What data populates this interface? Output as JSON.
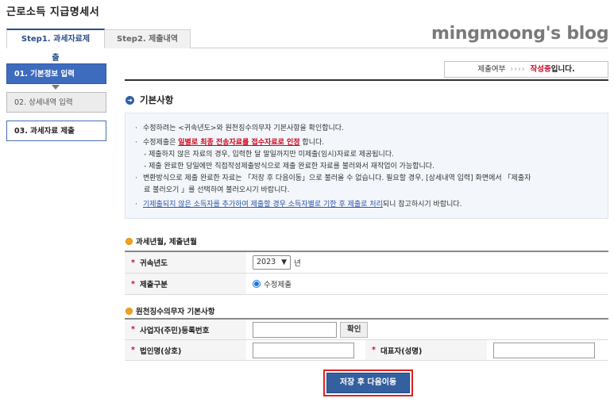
{
  "page": {
    "title": "근로소득 지급명세서"
  },
  "tabs": [
    {
      "label": "Step1. 과세자료제출"
    },
    {
      "label": "Step2. 제출내역"
    }
  ],
  "watermark": "mingmoong's blog",
  "left_nav": [
    {
      "label": "01. 기본정보 입력"
    },
    {
      "label": "02. 상세내역 입력"
    },
    {
      "label": "03. 과세자료 제출"
    }
  ],
  "status": {
    "label": "제출여부",
    "arrows": "››››",
    "value": "작성중",
    "suffix": "입니다."
  },
  "section": {
    "title": "기본사항"
  },
  "notice": {
    "line1": "수정하려는 <귀속년도>와 원천징수의무자 기본사항을 확인합니다.",
    "line2_prefix": "수정제출은 ",
    "line2_highlight": "일별로 최종 전송자료를 접수자료로 인정",
    "line2_suffix": " 합니다.",
    "line3": "- 제출하지 않은 자료의 경우, 입력한 달 말일까지만 미제출(임시)자료로 제공됩니다.",
    "line4": "- 제출 완료한 당일에만 직접작성제출방식으로 제출 완료한 자료를 불러와서 재작업이 가능합니다.",
    "line5": "변환방식으로 제출 완료한 자료는 「저장 후 다음이동」으로 불러올 수 없습니다. 필요할 경우, [상세내역 입력] 화면에서 「제출자",
    "line6": "료 불러오기 」를 선택하여 불러오시기 바랍니다.",
    "line7_link": "기제출되지 않은 소득자를 추가하여 제출할 경우 소득자별로 기한 후 제출로 처리",
    "line7_suffix": "되니 참고하시기 바랍니다."
  },
  "tax_period": {
    "heading": "과세년월, 제출년월",
    "year_label": "귀속년도",
    "year_value": "2023",
    "year_suffix": "년",
    "submit_label": "제출구분",
    "submit_value": "수정제출"
  },
  "withholder": {
    "heading": "원천징수의무자 기본사항",
    "bizno_label": "사업자(주민)등록번호",
    "confirm_label": "확인",
    "corp_label": "법인명(상호)",
    "rep_label": "대표자(성명)"
  },
  "save_button": {
    "label": "저장 후 다음이동"
  }
}
